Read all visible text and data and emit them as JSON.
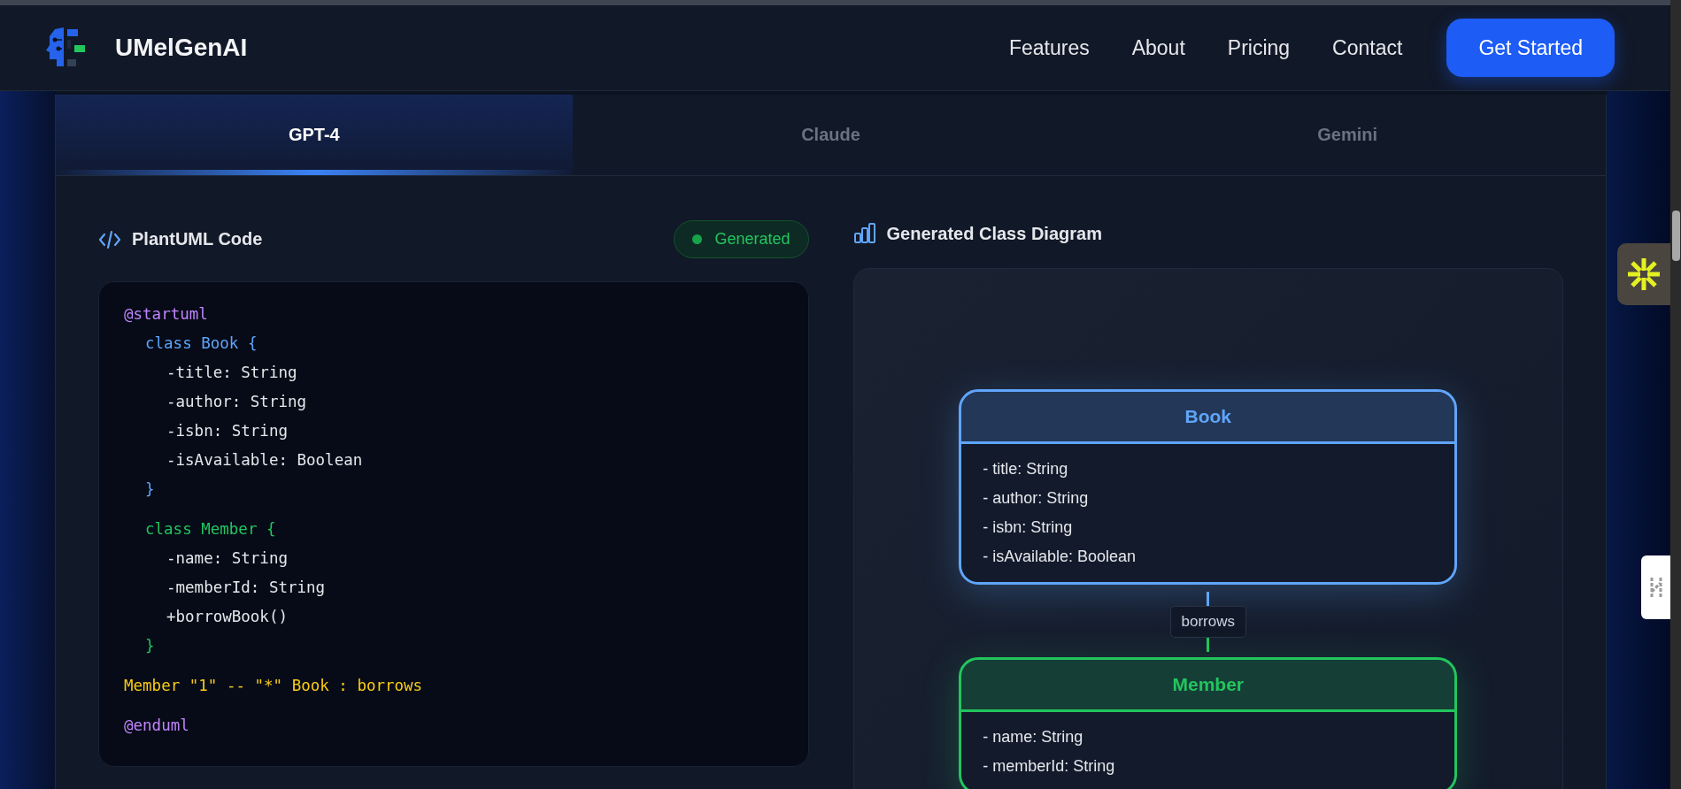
{
  "brand": {
    "name": "UMelGenAI"
  },
  "nav": {
    "links": [
      "Features",
      "About",
      "Pricing",
      "Contact"
    ],
    "cta": "Get Started"
  },
  "tabs": [
    {
      "label": "GPT-4",
      "selected": true
    },
    {
      "label": "Claude",
      "selected": false
    },
    {
      "label": "Gemini",
      "selected": false
    }
  ],
  "code_panel": {
    "title": "PlantUML Code",
    "status": "Generated",
    "blocks": [
      {
        "kind": "directive",
        "text": "@startuml"
      },
      {
        "kind": "class",
        "color": "#60a5fa",
        "text": "class Book {",
        "children": [
          "-title: String",
          "-author: String",
          "-isbn: String",
          "-isAvailable: Boolean"
        ],
        "close": "}"
      },
      {
        "kind": "class",
        "color": "#22c55e",
        "text": "class Member {",
        "children": [
          "-name: String",
          "-memberId: String",
          "+borrowBook()"
        ],
        "close": "}"
      },
      {
        "kind": "relation",
        "text": "Member \"1\" -- \"*\" Book : borrows"
      },
      {
        "kind": "directive",
        "text": "@enduml"
      }
    ]
  },
  "diagram_panel": {
    "title": "Generated Class Diagram",
    "classes": [
      {
        "name": "Book",
        "color": "#60a5fa",
        "attributes": [
          "- title: String",
          "- author: String",
          "- isbn: String",
          "- isAvailable: Boolean"
        ]
      },
      {
        "name": "Member",
        "color": "#22c55e",
        "attributes": [
          "- name: String",
          "- memberId: String"
        ]
      }
    ],
    "relation": "borrows"
  }
}
